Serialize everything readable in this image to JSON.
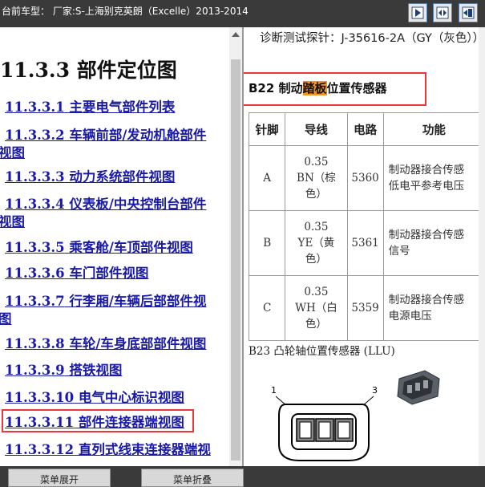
{
  "titlebar": {
    "text": "台前车型：  厂家:S-上海别克英朗（Excelle）2013-2014"
  },
  "toolbar": {
    "buttons": [
      "next-page-icon",
      "split-view-icon",
      "exit-icon"
    ]
  },
  "left": {
    "section_number": "11.3.3",
    "section_title": " 部件定位图",
    "links": [
      {
        "num": "11.3.3.1",
        "text": " 主要电气部件列表",
        "line2": ""
      },
      {
        "num": "11.3.3.2",
        "text": " 车辆前部/发动机舱部件",
        "line2": "视图"
      },
      {
        "num": "11.3.3.3",
        "text": " 动力系统部件视图",
        "line2": ""
      },
      {
        "num": "11.3.3.4",
        "text": " 仪表板/中央控制台部件",
        "line2": "视图"
      },
      {
        "num": "11.3.3.5",
        "text": " 乘客舱/车顶部件视图",
        "line2": ""
      },
      {
        "num": "11.3.3.6",
        "text": " 车门部件视图",
        "line2": ""
      },
      {
        "num": "11.3.3.7",
        "text": " 行李厢/车辆后部部件视",
        "line2": "图"
      },
      {
        "num": "11.3.3.8",
        "text": " 车轮/车身底部部件视图",
        "line2": ""
      },
      {
        "num": "11.3.3.9",
        "text": " 搭铁视图",
        "line2": ""
      },
      {
        "num": "11.3.3.10",
        "text": " 电气中心标识视图",
        "line2": ""
      },
      {
        "num": "11.3.3.11",
        "text": " 部件连接器端视图",
        "line2": ""
      },
      {
        "num": "11.3.3.12",
        "text": " 直列式线束连接器端视",
        "line2": ""
      }
    ]
  },
  "right": {
    "probe_text": "诊断测试探针：J-35616-2A（GY（灰色））",
    "b22": {
      "pre": "B22 制动",
      "highlight": "踏板",
      "post": "位置传感器"
    },
    "table": {
      "headers": [
        "针脚",
        "导线",
        "电路",
        "功能"
      ],
      "rows": [
        {
          "pin": "A",
          "wire_gauge": "0.35",
          "wire_color": "BN（棕色）",
          "circuit": "5360",
          "func1": "制动器接合传感",
          "func2": "低电平参考电压"
        },
        {
          "pin": "B",
          "wire_gauge": "0.35",
          "wire_color": "YE（黄色）",
          "circuit": "5361",
          "func1": "制动器接合传感",
          "func2": "信号"
        },
        {
          "pin": "C",
          "wire_gauge": "0.35",
          "wire_color": "WH（白色）",
          "circuit": "5359",
          "func1": "制动器接合传感",
          "func2": "电源电压"
        }
      ]
    },
    "b23_title": "B23 凸轮轴位置传感器 (LLU)",
    "connector_labels": {
      "left": "1",
      "right": "3"
    }
  },
  "bottom": {
    "menu_expand": "菜单展开",
    "menu_collapse": "菜单折叠"
  },
  "colors": {
    "link": "#1a1aa8",
    "highlight": "#f7941d",
    "frame_red": "#e8383d",
    "titlebar": "#3a3a3a"
  }
}
